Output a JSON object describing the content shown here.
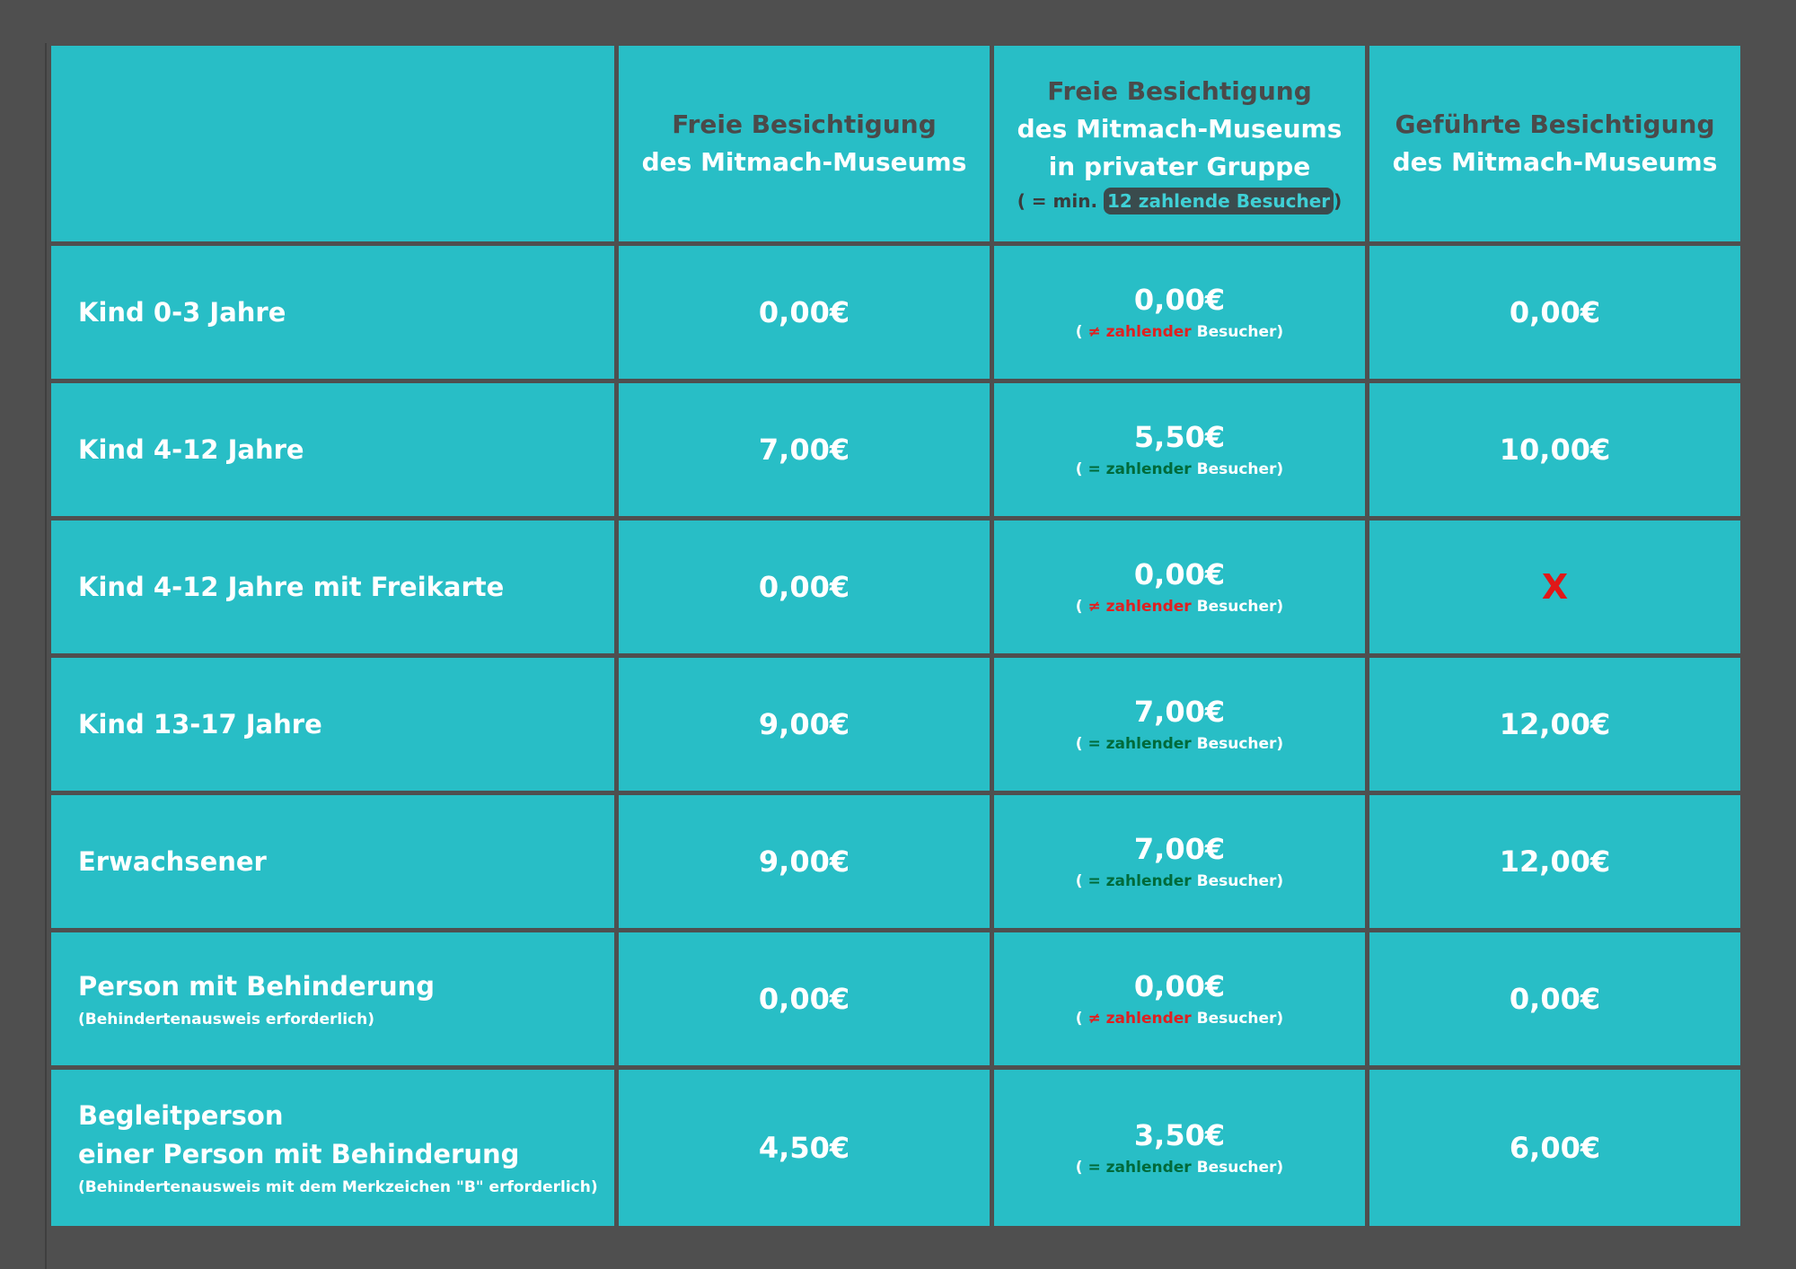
{
  "header": {
    "col_a": [
      "Freie Besichtigung",
      "des Mitmach-Museums"
    ],
    "col_b": [
      "Freie Besichtigung",
      "des Mitmach-Museums",
      "in privater Gruppe"
    ],
    "col_b_note": {
      "prefix": "( = min.",
      "pill": "12 zahlende Besucher",
      "suffix": ")"
    },
    "col_c": [
      "Geführte Besichtigung",
      "des Mitmach-Museums"
    ]
  },
  "notes": {
    "non_paying": {
      "open": "(",
      "mark": "≠ zahlender",
      "close": "Besucher)"
    },
    "paying": {
      "open": "(",
      "mark": "= zahlender",
      "close": "Besucher)"
    }
  },
  "rows": [
    {
      "label": "Kind 0-3 Jahre",
      "label2": "",
      "sub": "",
      "a": "0,00€",
      "b": "0,00€",
      "c": "0,00€"
    },
    {
      "label": "Kind 4-12 Jahre",
      "label2": "",
      "sub": "",
      "a": "7,00€",
      "b": "5,50€",
      "c": "10,00€"
    },
    {
      "label": "Kind 4-12 Jahre mit Freikarte",
      "label2": "",
      "sub": "",
      "a": "0,00€",
      "b": "0,00€",
      "c": "X"
    },
    {
      "label": "Kind 13-17 Jahre",
      "label2": "",
      "sub": "",
      "a": "9,00€",
      "b": "7,00€",
      "c": "12,00€"
    },
    {
      "label": "Erwachsener",
      "label2": "",
      "sub": "",
      "a": "9,00€",
      "b": "7,00€",
      "c": "12,00€"
    },
    {
      "label": "Person mit Behinderung",
      "label2": "",
      "sub": "(Behindertenausweis erforderlich)",
      "a": "0,00€",
      "b": "0,00€",
      "c": "0,00€"
    },
    {
      "label": "Begleitperson",
      "label2": "einer Person mit Behinderung",
      "sub": "(Behindertenausweis mit dem Merkzeichen \"B\" erforderlich)",
      "a": "4,50€",
      "b": "3,50€",
      "c": "6,00€"
    }
  ],
  "colors": {
    "background": "#4f4f4f",
    "cell": "#28bec6",
    "not_equal_mark": "#e02020",
    "equal_mark": "#006a3a",
    "unavailable_mark": "#e01818"
  }
}
